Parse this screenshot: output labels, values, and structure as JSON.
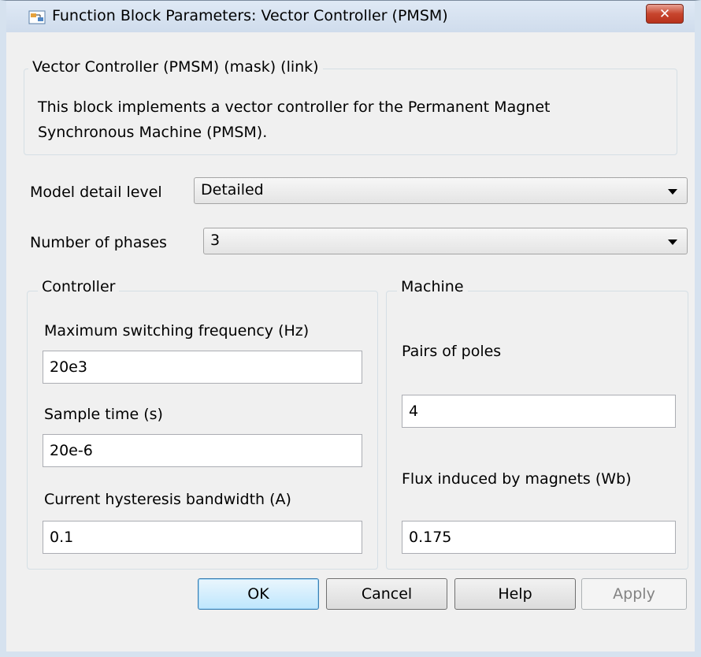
{
  "window": {
    "title": "Function Block Parameters: Vector Controller (PMSM)",
    "close_glyph": "✕",
    "app_icon": "simulink-block-icon"
  },
  "header": {
    "legend": "Vector Controller (PMSM) (mask) (link)",
    "description_line1": "This block implements a vector controller for the Permanent Magnet",
    "description_line2": "Synchronous Machine (PMSM)."
  },
  "model_detail": {
    "label": "Model detail level",
    "value": "Detailed"
  },
  "phases": {
    "label": "Number of phases",
    "value": "3"
  },
  "controller": {
    "legend": "Controller",
    "max_freq_label": "Maximum switching frequency (Hz)",
    "max_freq_value": "20e3",
    "sample_time_label": "Sample time (s)",
    "sample_time_value": "20e-6",
    "hysteresis_label": "Current hysteresis bandwidth (A)",
    "hysteresis_value": "0.1"
  },
  "machine": {
    "legend": "Machine",
    "pole_pairs_label": "Pairs of poles",
    "pole_pairs_value": "4",
    "flux_label": "Flux induced by magnets (Wb)",
    "flux_value": "0.175"
  },
  "buttons": {
    "ok": "OK",
    "cancel": "Cancel",
    "help": "Help",
    "apply": "Apply"
  },
  "colors": {
    "accent": "#3c7fb1",
    "close": "#c7452d",
    "window_bg": "#f0f0f0"
  }
}
